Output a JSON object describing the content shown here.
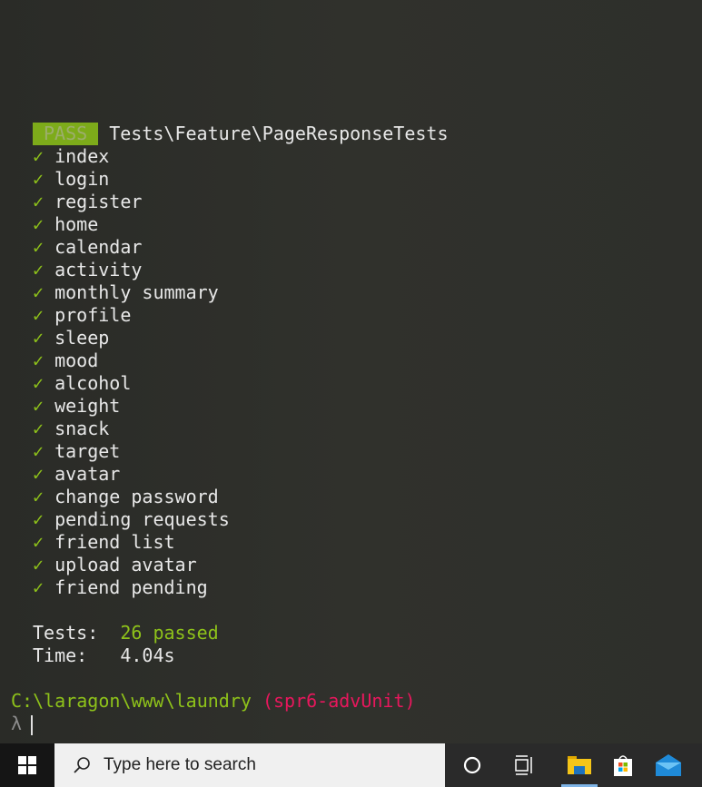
{
  "terminal": {
    "badge": "PASS",
    "suite": "Tests\\Feature\\PageResponseTests",
    "check_glyph": "✓",
    "tests": [
      "index",
      "login",
      "register",
      "home",
      "calendar",
      "activity",
      "monthly summary",
      "profile",
      "sleep",
      "mood",
      "alcohol",
      "weight",
      "snack",
      "target",
      "avatar",
      "change password",
      "pending requests",
      "friend list",
      "upload avatar",
      "friend pending"
    ],
    "summary_tests_label": "Tests:",
    "summary_tests_value": "26 passed",
    "summary_time_label": "Time:",
    "summary_time_value": "4.04s",
    "prompt_path": "C:\\laragon\\www\\laundry",
    "prompt_branch": "(spr6-advUnit)",
    "prompt_symbol": "λ"
  },
  "taskbar": {
    "search_placeholder": "Type here to search"
  },
  "colors": {
    "pass": "#7dab1a",
    "green": "#8ec21a",
    "branch": "#e8175d"
  }
}
